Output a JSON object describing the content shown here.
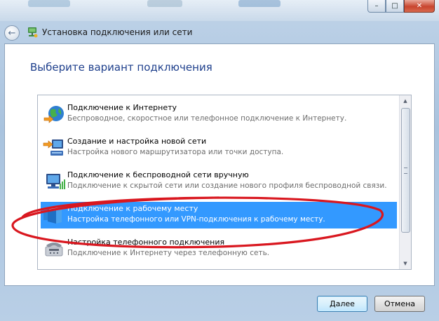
{
  "window": {
    "title": "Установка подключения или сети",
    "back_icon": "back-arrow-icon",
    "title_icon": "network-setup-icon",
    "controls": {
      "minimize": "–",
      "maximize": "□",
      "close": "✕"
    }
  },
  "page": {
    "heading": "Выберите вариант подключения"
  },
  "options": [
    {
      "title": "Подключение к Интернету",
      "description": "Беспроводное, скоростное или телефонное подключение к Интернету.",
      "icon": "globe-icon",
      "selected": false
    },
    {
      "title": "Создание и настройка новой сети",
      "description": "Настройка нового маршрутизатора или точки доступа.",
      "icon": "new-network-icon",
      "selected": false
    },
    {
      "title": "Подключение к беспроводной сети вручную",
      "description": "Подключение к скрытой сети или создание нового профиля беспроводной связи.",
      "icon": "wireless-network-icon",
      "selected": false
    },
    {
      "title": "Подключение к рабочему месту",
      "description": "Настройка телефонного или VPN-подключения к рабочему месту.",
      "icon": "workplace-icon",
      "selected": true
    },
    {
      "title": "Настройка телефонного подключения",
      "description": "Подключение к Интернету через телефонную сеть.",
      "icon": "phone-modem-icon",
      "selected": false
    }
  ],
  "scrollbar": {
    "up_arrow": "▲",
    "down_arrow": "▼"
  },
  "buttons": {
    "next": "Далее",
    "cancel": "Отмена"
  },
  "colors": {
    "heading": "#1e3f8c",
    "selection": "#3399ff",
    "annotation_ellipse": "#d9171f"
  }
}
